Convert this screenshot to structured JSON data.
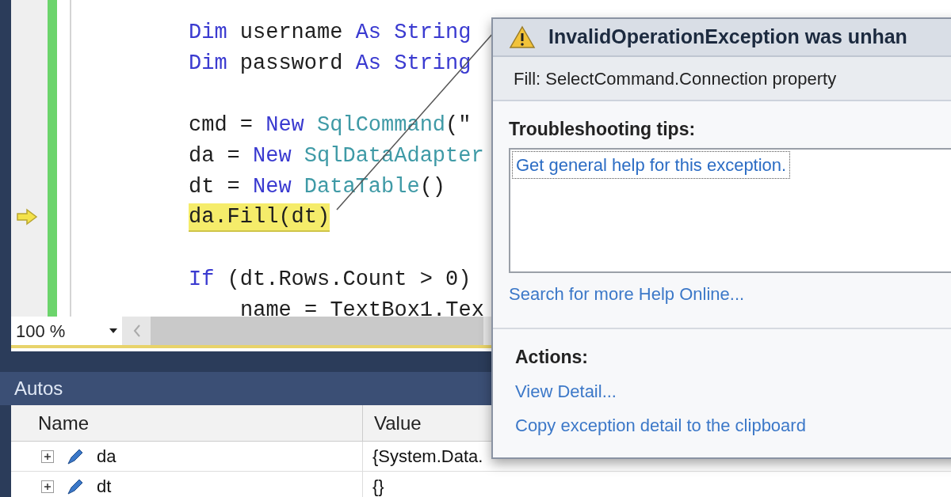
{
  "editor": {
    "blocks": [
      [
        {
          "segments": [
            {
              "text": "Dim",
              "kind": "keyword"
            },
            {
              "text": " username ",
              "kind": "plain"
            },
            {
              "text": "As",
              "kind": "keyword"
            },
            {
              "text": " String",
              "kind": "keyword"
            }
          ],
          "current": false
        },
        {
          "segments": [
            {
              "text": "Dim",
              "kind": "keyword"
            },
            {
              "text": " password ",
              "kind": "plain"
            },
            {
              "text": "As",
              "kind": "keyword"
            },
            {
              "text": " String",
              "kind": "keyword"
            }
          ],
          "current": false
        }
      ],
      [
        {
          "segments": [
            {
              "text": "cmd = ",
              "kind": "plain"
            },
            {
              "text": "New",
              "kind": "keyword"
            },
            {
              "text": " SqlCommand",
              "kind": "type"
            },
            {
              "text": "(\"",
              "kind": "plain"
            }
          ],
          "current": false
        },
        {
          "segments": [
            {
              "text": "da = ",
              "kind": "plain"
            },
            {
              "text": "New",
              "kind": "keyword"
            },
            {
              "text": " SqlDataAdapter",
              "kind": "type"
            }
          ],
          "current": false
        },
        {
          "segments": [
            {
              "text": "dt = ",
              "kind": "plain"
            },
            {
              "text": "New",
              "kind": "keyword"
            },
            {
              "text": " DataTable",
              "kind": "type"
            },
            {
              "text": "()",
              "kind": "plain"
            }
          ],
          "current": false
        },
        {
          "segments": [
            {
              "text": "da.Fill(dt)",
              "kind": "plain"
            }
          ],
          "current": true
        }
      ],
      [
        {
          "segments": [
            {
              "text": "If",
              "kind": "keyword"
            },
            {
              "text": " (dt.Rows.Count > 0)",
              "kind": "plain"
            }
          ],
          "current": false,
          "children": [
            {
              "segments": [
                {
                  "text": "name = TextBox1.Tex",
                  "kind": "plain"
                }
              ],
              "current": false
            }
          ]
        }
      ]
    ],
    "zoom": "100 %"
  },
  "exception": {
    "title": "InvalidOperationException was unhan",
    "message": "Fill: SelectCommand.Connection property",
    "tips_heading": "Troubleshooting tips:",
    "tips": [
      "Get general help for this exception."
    ],
    "search_link": "Search for more Help Online...",
    "actions_heading": "Actions:",
    "actions": [
      "View Detail...",
      "Copy exception detail to the clipboard"
    ]
  },
  "autos": {
    "title": "Autos",
    "columns": [
      "Name",
      "Value"
    ],
    "rows": [
      {
        "name": "da",
        "value": "{System.Data.",
        "expanded": false
      },
      {
        "name": "dt",
        "value": "{}",
        "expanded": false
      }
    ]
  }
}
